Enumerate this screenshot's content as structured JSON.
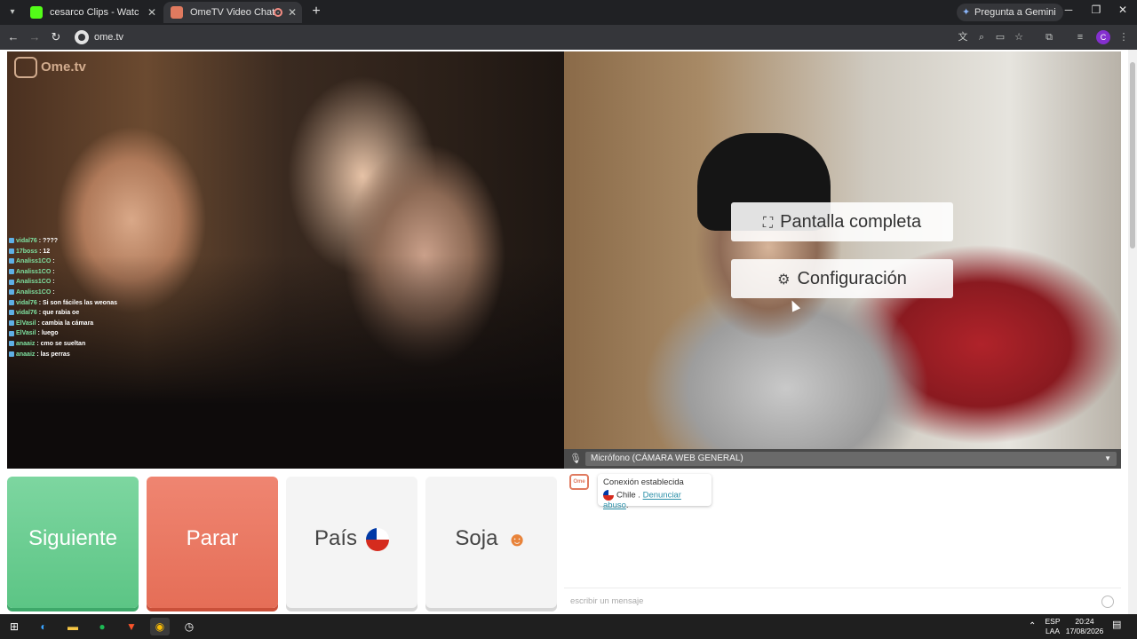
{
  "browser": {
    "tabs": [
      {
        "title": "cesarco Clips - Watch Live on K",
        "favicon_color": "#53fc18",
        "active": false
      },
      {
        "title": "OmeTV Video Chat — Alte",
        "favicon_color": "#e07a5f",
        "active": true
      }
    ],
    "gemini_label": "Pregunta a Gemini",
    "url": "ome.tv"
  },
  "page": {
    "logo_text": "Ome.tv",
    "chat_overlay": [
      {
        "user": "vidal76",
        "text": "????"
      },
      {
        "user": "17boss",
        "text": "12"
      },
      {
        "user": "Analiss1CO",
        "text": ""
      },
      {
        "user": "Analiss1CO",
        "text": ""
      },
      {
        "user": "Analiss1CO",
        "text": ""
      },
      {
        "user": "Analiss1CO",
        "text": ""
      },
      {
        "user": "vidal76",
        "text": "Si son fáciles las weonas"
      },
      {
        "user": "vidal76",
        "text": "que rabia oe"
      },
      {
        "user": "ElVasil",
        "text": "cambia la cámara"
      },
      {
        "user": "ElVasil",
        "text": "luego"
      },
      {
        "user": "anaaiz",
        "text": "cmo se sueltan"
      },
      {
        "user": "anaaiz",
        "text": "las perras"
      }
    ],
    "overlay_buttons": {
      "fullscreen": "Pantalla completa",
      "settings": "Configuración"
    },
    "microphone_label": "Micrófono (CÁMARA WEB GENERAL)",
    "controls": {
      "next": "Siguiente",
      "stop": "Parar",
      "country": "País",
      "gender": "Soja"
    },
    "chat": {
      "connection_status": "Conexión establecida",
      "country_name": "Chile",
      "separator": " . ",
      "report_link": "Denunciar abuso",
      "report_suffix": ".",
      "input_placeholder": "escribir un mensaje"
    }
  },
  "taskbar": {
    "language_top": "ESP",
    "language_bottom": "LAA",
    "time": "20:24",
    "date": "17/08/2026"
  },
  "colors": {
    "next_button": "#5cc585",
    "stop_button": "#e56e57",
    "link": "#2a8fa8"
  }
}
